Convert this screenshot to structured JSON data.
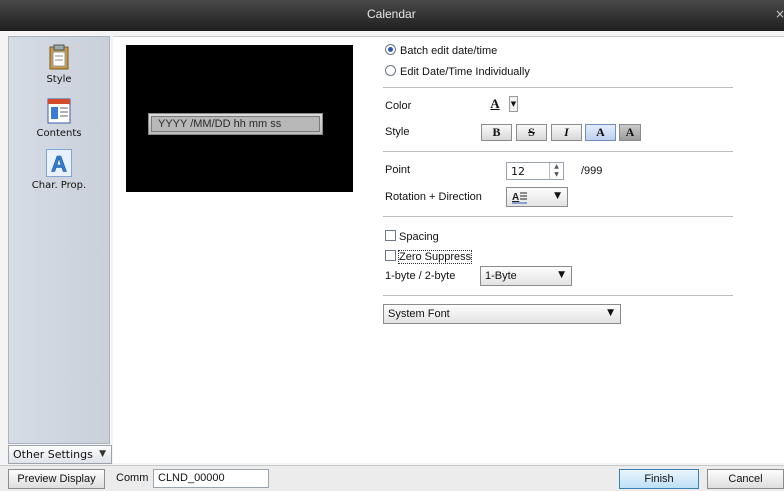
{
  "window": {
    "title": "Calendar",
    "close": "×"
  },
  "sidebar": {
    "items": [
      {
        "label": "Style",
        "icon": "clipboard-icon"
      },
      {
        "label": "Contents",
        "icon": "document-layout-icon"
      },
      {
        "label": "Char. Prop.",
        "icon": "letter-a-icon"
      }
    ],
    "other_settings": "Other Settings"
  },
  "preview": {
    "format_text": "YYYY  /MM/DD  hh  mm  ss"
  },
  "options": {
    "batch_edit": "Batch edit date/time",
    "individual_edit": "Edit Date/Time Individually",
    "color_label": "Color",
    "color_glyph": "A",
    "style_label": "Style",
    "style_buttons": [
      "B",
      "S",
      "I",
      "A",
      "A"
    ],
    "point_label": "Point",
    "point_value": "12",
    "point_max": "/999",
    "rotation_label": "Rotation + Direction",
    "spacing": "Spacing",
    "zero_suppress": "Zero Suppress",
    "byte_label": "1-byte / 2-byte",
    "byte_value": "1-Byte",
    "font_value": "System Font"
  },
  "bottom": {
    "preview_button": "Preview Display",
    "comm_label": "Comm",
    "comm_value": "CLND_00000",
    "finish": "Finish",
    "cancel": "Cancel"
  },
  "colors": {
    "title_bg": "#2b2b2b",
    "accent": "#2b59b8",
    "finish_border": "#3c7fb1"
  }
}
